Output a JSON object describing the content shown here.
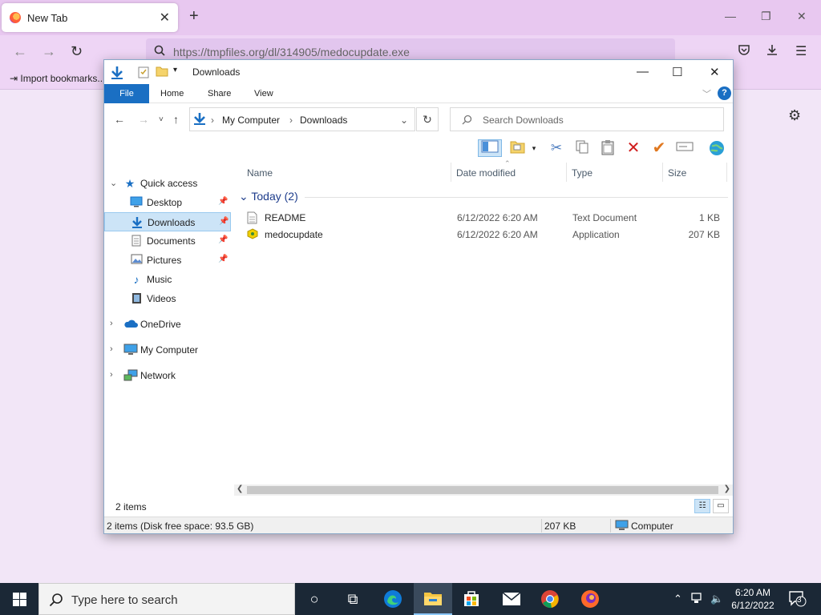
{
  "browser": {
    "tab_title": "New Tab",
    "url": "https://tmpfiles.org/dl/314905/medocupdate.exe",
    "bookmark_label": "Import bookmarks..."
  },
  "explorer": {
    "title": "Downloads",
    "ribbon_tabs": [
      "File",
      "Home",
      "Share",
      "View"
    ],
    "breadcrumb": [
      "My Computer",
      "Downloads"
    ],
    "search_placeholder": "Search Downloads",
    "nav": {
      "quick_access": "Quick access",
      "desktop": "Desktop",
      "downloads": "Downloads",
      "documents": "Documents",
      "pictures": "Pictures",
      "music": "Music",
      "videos": "Videos",
      "onedrive": "OneDrive",
      "my_computer": "My Computer",
      "network": "Network"
    },
    "columns": {
      "name": "Name",
      "date": "Date modified",
      "type": "Type",
      "size": "Size"
    },
    "group_label": "Today (2)",
    "files": [
      {
        "name": "README",
        "date": "6/12/2022 6:20 AM",
        "type": "Text Document",
        "size": "1 KB"
      },
      {
        "name": "medocupdate",
        "date": "6/12/2022 6:20 AM",
        "type": "Application",
        "size": "207 KB"
      }
    ],
    "item_count": "2 items",
    "status_free": "2 items (Disk free space: 93.5 GB)",
    "status_size": "207 KB",
    "status_location": "Computer"
  },
  "taskbar": {
    "search_placeholder": "Type here to search",
    "time": "6:20 AM",
    "date": "6/12/2022",
    "notification_count": "3"
  },
  "colors": {
    "accent": "#1a6fc3",
    "browser_tabbar": "#e8c8f0",
    "taskbar": "#1b2836"
  }
}
